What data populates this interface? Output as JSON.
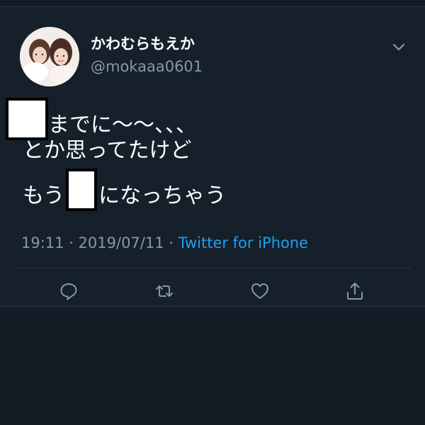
{
  "tweet": {
    "author": {
      "display_name": "かわむらもえか",
      "handle": "@mokaaa0601"
    },
    "text_lines": [
      "までに〜〜、、、",
      "とか思ってたけど",
      "もう",
      "になっちゃう"
    ],
    "timestamp": "19:11 · 2019/07/11 · ",
    "source": "Twitter for iPhone"
  },
  "icons": {
    "menu": "chevron-down-icon",
    "reply": "reply-icon",
    "retweet": "retweet-icon",
    "like": "heart-icon",
    "share": "share-icon"
  },
  "colors": {
    "background": "#141d26",
    "card": "#15202b",
    "primary_text": "#ffffff",
    "secondary_text": "#8899a6",
    "link": "#1da1f2"
  }
}
